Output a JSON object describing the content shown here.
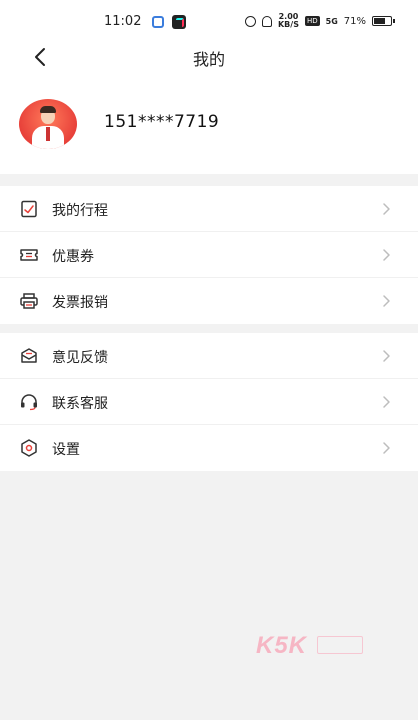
{
  "status_bar": {
    "time": "11:02",
    "speed_value": "2.00",
    "speed_unit": "KB/S",
    "hd": "HD",
    "signal": "5G",
    "battery": "71%",
    "battery_level": 0.71
  },
  "nav": {
    "title": "我的",
    "back_icon": "chevron-left-icon"
  },
  "profile": {
    "phone": "151****7719",
    "avatar": "avatar-man-icon"
  },
  "menu_groups": [
    {
      "items": [
        {
          "label": "我的行程",
          "icon": "itinerary-icon"
        },
        {
          "label": "优惠券",
          "icon": "coupon-icon"
        },
        {
          "label": "发票报销",
          "icon": "invoice-printer-icon"
        }
      ]
    },
    {
      "items": [
        {
          "label": "意见反馈",
          "icon": "feedback-mail-icon"
        },
        {
          "label": "联系客服",
          "icon": "headset-icon"
        },
        {
          "label": "设置",
          "icon": "settings-icon"
        }
      ]
    }
  ],
  "colors": {
    "page_bg": "#f2f2f2",
    "card_bg": "#ffffff",
    "avatar_bg": "#e8413a",
    "chevron": "#bdbdbd",
    "watermark": "#f6b6c4"
  },
  "watermark": "K5K"
}
